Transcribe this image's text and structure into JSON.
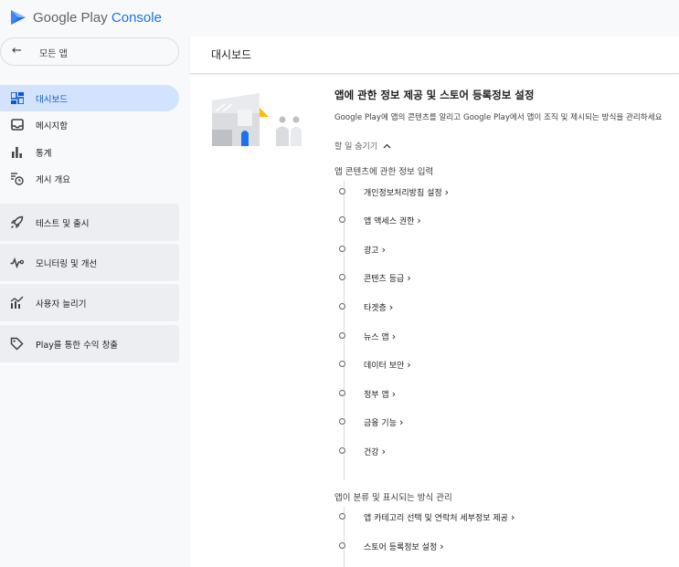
{
  "app": {
    "brand_google_play": "Google Play",
    "brand_console": "Console"
  },
  "sidebar": {
    "back_label": "모든 앱",
    "items": [
      {
        "label": "대시보드",
        "active": true
      },
      {
        "label": "메시지함"
      },
      {
        "label": "통계"
      },
      {
        "label": "게시 개요"
      }
    ],
    "groups": [
      {
        "label": "테스트 및 출시"
      },
      {
        "label": "모니터링 및 개선"
      },
      {
        "label": "사용자 늘리기"
      },
      {
        "label": "Play를 통한 수익 창출"
      }
    ]
  },
  "main": {
    "title": "대시보드",
    "section": {
      "title": "앱에 관한 정보 제공 및 스토어 등록정보 설정",
      "description": "Google Play에 앱의 콘텐츠를 알리고 Google Play에서 앱이 조직 및 제시되는 방식을 관리하세요",
      "toggle_label": "할 일 숨기기"
    },
    "group1": {
      "heading": "앱 콘텐츠에 관한 정보 입력",
      "tasks": [
        "개인정보처리방침 설정",
        "앱 액세스 권한",
        "광고",
        "콘텐츠 등급",
        "타겟층",
        "뉴스 앱",
        "데이터 보안",
        "정부 앱",
        "금융 기능",
        "건강"
      ]
    },
    "group2": {
      "heading": "앱이 분류 및 표시되는 방식 관리",
      "tasks": [
        "앱 카테고리 선택 및 연락처 세부정보 제공",
        "스토어 등록정보 설정"
      ]
    }
  },
  "colors": {
    "accent": "#1a73e8",
    "active_bg": "#d3e3fd",
    "group_bg": "#eceef1"
  }
}
